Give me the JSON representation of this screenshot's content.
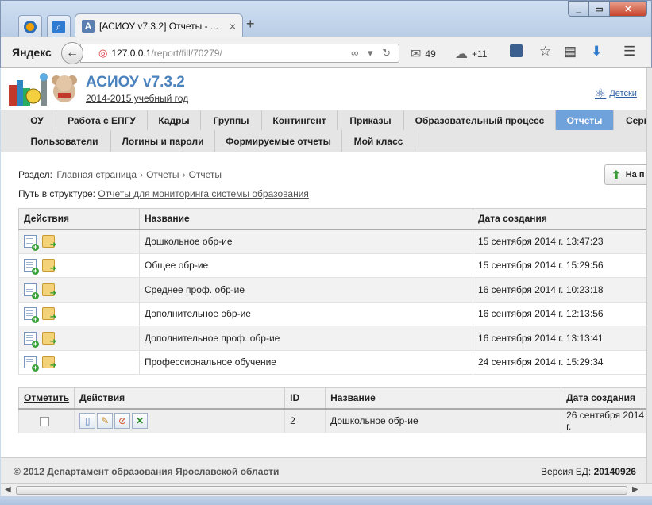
{
  "browser": {
    "tab_title": "[АСИОУ v7.3.2] Отчеты - ...",
    "tab_icon_letter": "A",
    "newtab": "+",
    "close": "×",
    "yandex_brand": "Яндекс",
    "url_host": "127.0.0.1",
    "url_path": "/report/fill/70279/",
    "mail_count": "49",
    "weather": "+11",
    "win_min": "_",
    "win_max": "▭",
    "win_close": "✕"
  },
  "header": {
    "title": "АСИОУ v7.3.2",
    "year": "2014-2015 учебный год",
    "right_link": "Детски"
  },
  "menu": {
    "row1": [
      "ОУ",
      "Работа с ЕПГУ",
      "Кадры",
      "Группы",
      "Контингент",
      "Приказы",
      "Образовательный процесс",
      "Отчеты",
      "Серв"
    ],
    "row2": [
      "Пользователи",
      "Логины и пароли",
      "Формируемые отчеты",
      "Мой класс"
    ],
    "active": "Отчеты"
  },
  "breadcrumb": {
    "label": "Раздел:",
    "items": [
      "Главная страница",
      "Отчеты",
      "Отчеты"
    ],
    "sep": "›"
  },
  "path": {
    "label": "Путь в структуре:",
    "link": "Отчеты для мониторинга системы образования"
  },
  "top_button": {
    "label": "На п"
  },
  "table1": {
    "headers": [
      "Действия",
      "Название",
      "Дата создания"
    ],
    "rows": [
      {
        "name": "Дошкольное обр-ие",
        "date": "15 сентября 2014 г. 13:47:23"
      },
      {
        "name": "Общее обр-ие",
        "date": "15 сентября 2014 г. 15:29:56"
      },
      {
        "name": "Среднее проф. обр-ие",
        "date": "16 сентября 2014 г. 10:23:18"
      },
      {
        "name": "Дополнительное обр-ие",
        "date": "16 сентября 2014 г. 12:13:56"
      },
      {
        "name": "Дополнительное проф. обр-ие",
        "date": "16 сентября 2014 г. 13:13:41"
      },
      {
        "name": "Профессиональное обучение",
        "date": "24 сентября 2014 г. 15:29:34"
      }
    ]
  },
  "table2": {
    "headers": [
      "Отметить",
      "Действия",
      "ID",
      "Название",
      "Дата создания"
    ],
    "rows": [
      {
        "id": "2",
        "name": "Дошкольное обр-ие",
        "date": "26 сентября 2014 г."
      }
    ]
  },
  "footer": {
    "copyright": "© 2012 Департамент образования Ярославской области",
    "version_label": "Версия БД:",
    "version_value": "20140926"
  }
}
